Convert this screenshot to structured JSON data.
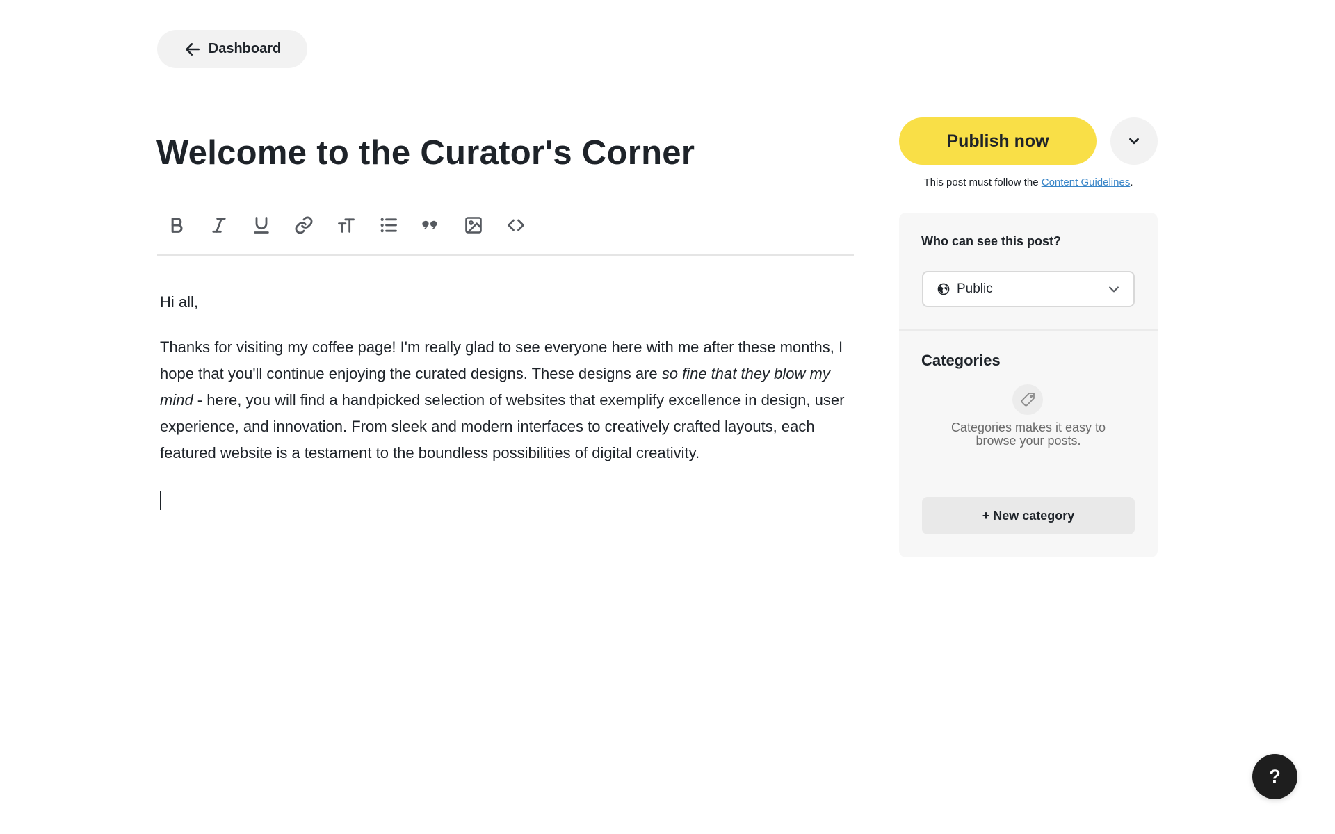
{
  "nav": {
    "back_label": "Dashboard",
    "back_icon": "arrow-left-icon"
  },
  "post": {
    "title": "Welcome to the Curator's Corner",
    "greeting": "Hi all,",
    "body_before_italic": "Thanks for visiting my coffee page! I'm really glad to see everyone here with me after these months, I hope that you'll continue enjoying the curated designs. These designs are ",
    "body_italic": "so fine that they blow my mind",
    "body_after_italic": " - here, you will find a handpicked selection of websites that exemplify excellence in design, user experience, and innovation. From sleek and modern interfaces to creatively crafted layouts, each featured website is a testament to the boundless possibilities of digital creativity."
  },
  "toolbar": {
    "tools": [
      "bold-icon",
      "italic-icon",
      "underline-icon",
      "link-icon",
      "text-size-icon",
      "list-icon",
      "quote-icon",
      "image-icon",
      "code-icon"
    ]
  },
  "publish": {
    "button_label": "Publish now",
    "note_prefix": "This post must follow the ",
    "note_link": "Content Guidelines",
    "note_suffix": ".",
    "accent_color": "#f9df47"
  },
  "visibility": {
    "label": "Who can see this post?",
    "selected": "Public"
  },
  "categories": {
    "title": "Categories",
    "empty_text": "Categories makes it easy to browse your posts.",
    "new_button_label": "+ New category"
  },
  "help": {
    "label": "?"
  },
  "colors": {
    "link": "#3a86c8",
    "text": "#1e2329",
    "help_bg": "#1e1e1e"
  }
}
